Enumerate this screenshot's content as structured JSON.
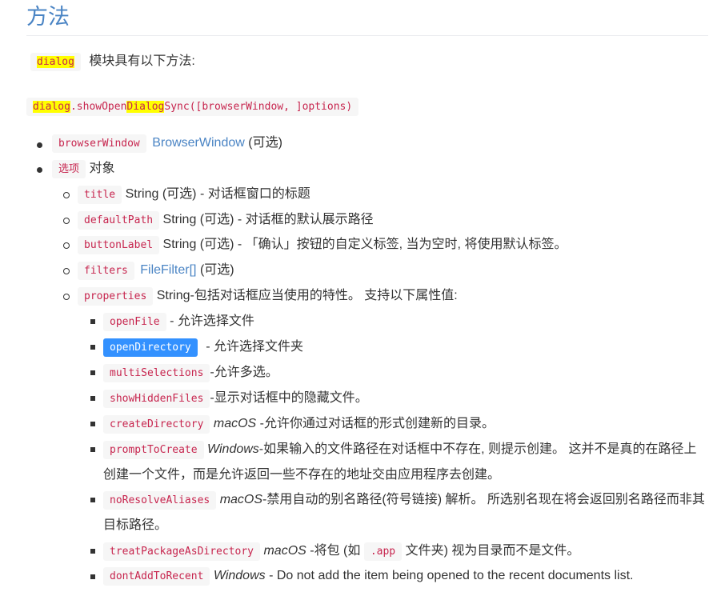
{
  "heading": "方法",
  "intro": {
    "code": "dialog",
    "text": "模块具有以下方法:"
  },
  "signature": {
    "prefix": "dialog",
    "middle": ".showOpen",
    "hl": "Dialog",
    "suffix": "Sync([browserWindow, ]options)"
  },
  "params": [
    {
      "code": "browserWindow",
      "link": "BrowserWindow",
      "text": "(可选)"
    },
    {
      "code": "选项",
      "text": "对象"
    }
  ],
  "options": [
    {
      "code": "title",
      "text": "String (可选) - 对话框窗口的标题"
    },
    {
      "code": "defaultPath",
      "text": "String (可选) - 对话框的默认展示路径"
    },
    {
      "code": "buttonLabel",
      "text": "String (可选) - 「确认」按钮的自定义标签, 当为空时, 将使用默认标签。"
    },
    {
      "code": "filters",
      "link": "FileFilter[]",
      "text": "(可选)"
    },
    {
      "code": "properties",
      "text": "String-包括对话框应当使用的特性。 支持以下属性值:"
    }
  ],
  "properties": [
    {
      "code": "openFile",
      "text": "- 允许选择文件"
    },
    {
      "code": "openDirectory",
      "text": "- 允许选择文件夹",
      "selected": true
    },
    {
      "code": "multiSelections",
      "text": "-允许多选。"
    },
    {
      "code": "showHiddenFiles",
      "text": "-显示对话框中的隐藏文件。"
    },
    {
      "code": "createDirectory",
      "platform": "macOS",
      "text": "-允许你通过对话框的形式创建新的目录。"
    },
    {
      "code": "promptToCreate",
      "platform": "Windows",
      "text": "-如果输入的文件路径在对话框中不存在, 则提示创建。 这并不是真的在路径上",
      "cont": "创建一个文件，而是允许返回一些不存在的地址交由应用程序去创建。"
    },
    {
      "code": "noResolveAliases",
      "platform": "macOS",
      "text": "-禁用自动的别名路径(符号链接) 解析。 所选别名现在将会返回别名路径而非其",
      "cont": "目标路径。"
    },
    {
      "code": "treatPackageAsDirectory",
      "platform": "macOS",
      "text": "-将包 (如",
      "code2": ".app",
      "text2": "文件夹) 视为目录而不是文件。"
    },
    {
      "code": "dontAddToRecent",
      "platform": "Windows",
      "text": "- Do not add the item being opened to the recent documents list."
    }
  ]
}
